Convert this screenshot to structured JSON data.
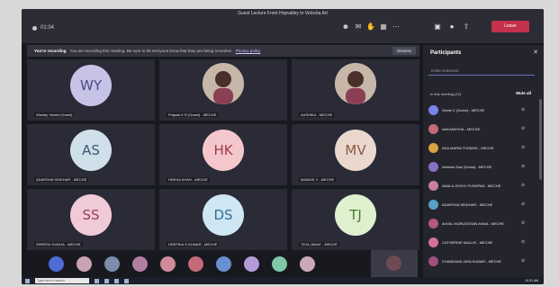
{
  "meeting": {
    "title": "Guest Lecture From Hopvalley to Velocita Art",
    "timer": "01:04",
    "leave_label": "Leave"
  },
  "recording_banner": {
    "title": "You're recording",
    "message": "You are recording this meeting. Be sure to let everyone know that they are being recorded.",
    "link": "Privacy policy",
    "dismiss": "Dismiss"
  },
  "tiles": [
    {
      "initials": "WY",
      "name": "Wesley Yamini (Guest)",
      "bg": "#c7c3e6",
      "fg": "#4a4a8a",
      "photo": false
    },
    {
      "initials": "",
      "name": "Prajwal K R (Guest) - MECHE",
      "bg": "",
      "fg": "",
      "photo": true
    },
    {
      "initials": "",
      "name": "AASHIKA - MECHE",
      "bg": "",
      "fg": "",
      "photo": true
    },
    {
      "initials": "AS",
      "name": "ADARSHA SRIDHAR - MECHE",
      "bg": "#cfe0ea",
      "fg": "#3a5a74",
      "photo": false
    },
    {
      "initials": "HK",
      "name": "HEENA KHAN - MECHE",
      "bg": "#f3c7cc",
      "fg": "#a23a4a",
      "photo": false
    },
    {
      "initials": "MV",
      "name": "MANASI V - MECHE",
      "bg": "#ead8cf",
      "fg": "#8a5a44",
      "photo": false
    },
    {
      "initials": "SS",
      "name": "SHRESH SUDHA - MECHE",
      "bg": "#f0cbd7",
      "fg": "#9a3a5e",
      "photo": false
    },
    {
      "initials": "DS",
      "name": "DEEPIKA S KUMAR - MECHE",
      "bg": "#cfe6f3",
      "fg": "#2f6e96",
      "photo": false
    },
    {
      "initials": "TJ",
      "name": "TEJA JANAT - MECHE",
      "bg": "#dff0cf",
      "fg": "#4e7a2e",
      "photo": false
    }
  ],
  "avatar_row_colors": [
    "#4f6bd6",
    "#c9a3b0",
    "#7d8caa",
    "#b07fa4",
    "#d28b9c",
    "#c46a79",
    "#6a8fd0",
    "#b49bd8",
    "#7fc7a9",
    "#c9a9b9"
  ],
  "participants": {
    "title": "Participants",
    "invite_placeholder": "Invite someone",
    "in_meeting_label": "In this meeting (22)",
    "mute_all": "Mute all",
    "list": [
      {
        "name": "Guest C (Guest) - MECHE",
        "sub": "Organizer",
        "color": "#7b83eb"
      },
      {
        "name": "AAKANKSHA - MECHE",
        "sub": "",
        "color": "#c46a79"
      },
      {
        "name": "ADA MARIA THOMAS - MECHE",
        "sub": "",
        "color": "#d9a441"
      },
      {
        "name": "Abhisha Das (Guest) - MECHE",
        "sub": "",
        "color": "#8a6fc7"
      },
      {
        "name": "ANALA JOSHY PUSHPAN - MECHE",
        "sub": "",
        "color": "#c77fa3"
      },
      {
        "name": "ADARSHA SRIDHAR - MECHE",
        "sub": "",
        "color": "#5aa0c8"
      },
      {
        "name": "AVVAL MURUGESAN ANNA - MECHE",
        "sub": "",
        "color": "#b35a7a"
      },
      {
        "name": "CATHERINE MALLIK - MECHE",
        "sub": "",
        "color": "#d4709a"
      },
      {
        "name": "CHANDANA JAYA KUMAR - MECHE",
        "sub": "",
        "color": "#a04f7e"
      }
    ]
  },
  "taskbar": {
    "search_placeholder": "Type here to search",
    "clock": "10:31 AM"
  }
}
